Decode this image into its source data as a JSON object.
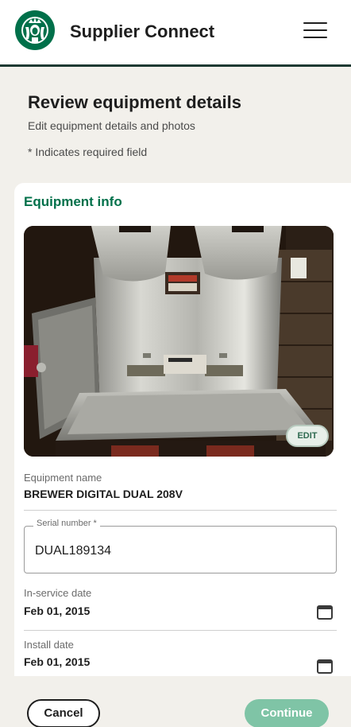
{
  "header": {
    "app_title": "Supplier Connect",
    "logo_icon": "starbucks-siren-logo",
    "menu_icon": "hamburger-menu-icon"
  },
  "page": {
    "title": "Review equipment details",
    "subtitle": "Edit equipment details and photos",
    "required_note": "* Indicates required field"
  },
  "equipment": {
    "section_title": "Equipment info",
    "photo_edit_label": "EDIT",
    "name_label": "Equipment name",
    "name_value": "BREWER DIGITAL DUAL 208V",
    "serial_label": "Serial number *",
    "serial_value": "DUAL189134",
    "in_service_label": "In-service date",
    "in_service_value": "Feb 01, 2015",
    "install_label": "Install date",
    "install_value": "Feb 01, 2015",
    "calendar_icon": "calendar-icon"
  },
  "footer": {
    "cancel_label": "Cancel",
    "continue_label": "Continue"
  },
  "colors": {
    "brand_green": "#00704a",
    "header_rule": "#1e3932",
    "continue_disabled": "#7fc4a6",
    "background": "#f2f0eb"
  }
}
